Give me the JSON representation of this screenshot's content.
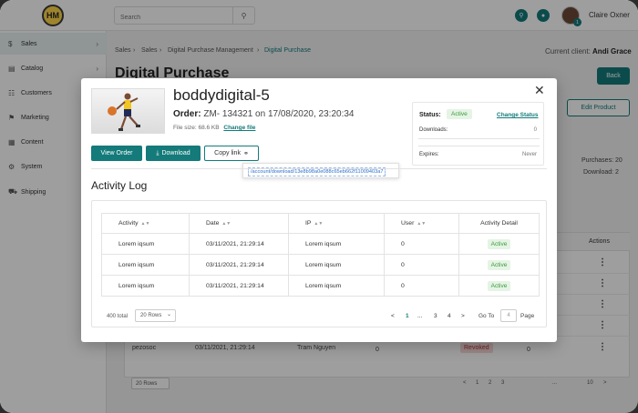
{
  "topbar": {
    "logo_text": "HM",
    "search_placeholder": "Search",
    "search_icon": "search-icon",
    "notification_badge": "1",
    "user_name": "Claire Oxner"
  },
  "sidebar": {
    "items": [
      {
        "label": "Sales",
        "icon": "dollar-icon"
      },
      {
        "label": "Catalog",
        "icon": "catalog-icon"
      },
      {
        "label": "Customers",
        "icon": "customers-icon"
      },
      {
        "label": "Marketing",
        "icon": "megaphone-icon"
      },
      {
        "label": "Content",
        "icon": "content-icon"
      },
      {
        "label": "System",
        "icon": "system-icon"
      },
      {
        "label": "Shipping",
        "icon": "truck-icon"
      }
    ]
  },
  "breadcrumb": {
    "items": [
      "Sales",
      "Sales",
      "Digital Purchase Management",
      "Digital Purchase"
    ]
  },
  "client": {
    "label": "Current client:",
    "name": "Andi Grace"
  },
  "page": {
    "title": "Digital Purchase",
    "back_label": "Back",
    "edit_label": "Edit Product",
    "purchases": "Purchases: 20",
    "download": "Download: 2",
    "actions_header": "Actions",
    "row_user": "pezosoc",
    "row_date": "03/11/2021, 21:29:14",
    "row_ip": "Tram Nguyen",
    "row_zero": "0",
    "revoked": "Revoked",
    "rows_select": "20 Rows",
    "pages": [
      "<",
      "1",
      "2",
      "3",
      "...",
      "10",
      ">"
    ]
  },
  "modal": {
    "title": "boddydigital-5",
    "order_label": "Order:",
    "order_value": "ZM- 134321 on 17/08/2020, 23:20:34",
    "file_size": "File size: 68.6 KB",
    "change_file": "Change file",
    "view_order": "View Order",
    "download": "Download",
    "copy_link": "Copy link",
    "copy_url": "/account/download/13e8b98a0e088c65eb662f11009403a7",
    "status": {
      "label": "Status:",
      "value": "Active",
      "change_label": "Change Status",
      "downloads_label": "Downloads:",
      "downloads_value": "0",
      "expires_label": "Expires:",
      "expires_value": "Never"
    },
    "activity": {
      "title": "Activity Log",
      "headers": [
        "Activity",
        "Date",
        "IP",
        "User",
        "Activity Detail"
      ],
      "rows": [
        {
          "activity": "Lorem iqsum",
          "date": "03/11/2021, 21:29:14",
          "ip": "Lorem iqsum",
          "user": "0",
          "detail": "Active"
        },
        {
          "activity": "Lorem iqsum",
          "date": "03/11/2021, 21:29:14",
          "ip": "Lorem iqsum",
          "user": "0",
          "detail": "Active"
        },
        {
          "activity": "Lorem iqsum",
          "date": "03/11/2021, 21:29:14",
          "ip": "Lorem iqsum",
          "user": "0",
          "detail": "Active"
        }
      ],
      "total": "400 total",
      "rows_select": "20 Rows",
      "pages": [
        "<",
        "1",
        "...",
        "3",
        "4",
        ">"
      ],
      "goto": "Go To",
      "goto_value": "4",
      "page_label": "Page"
    }
  },
  "colors": {
    "accent": "#147a7a",
    "active_bg": "#e5f4e5",
    "active_text": "#3a9a3a",
    "revoked_bg": "#f8d7d7"
  }
}
